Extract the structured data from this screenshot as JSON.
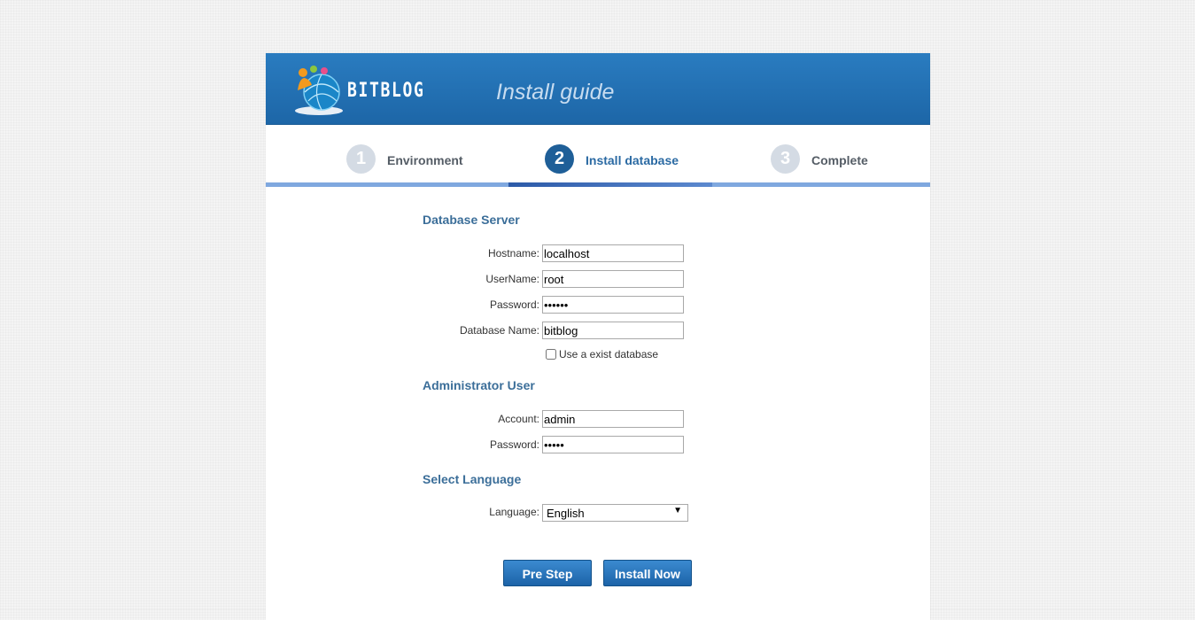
{
  "header": {
    "logo_text": "BITBLOG",
    "title": "Install guide"
  },
  "steps": [
    {
      "num": "1",
      "label": "Environment",
      "active": false
    },
    {
      "num": "2",
      "label": "Install database",
      "active": true
    },
    {
      "num": "3",
      "label": "Complete",
      "active": false
    }
  ],
  "database_server": {
    "title": "Database Server",
    "hostname_label": "Hostname:",
    "hostname_value": "localhost",
    "username_label": "UserName:",
    "username_value": "root",
    "password_label": "Password:",
    "password_value": "••••••",
    "dbname_label": "Database Name:",
    "dbname_value": "bitblog",
    "use_exist_label": "Use a exist database"
  },
  "admin_user": {
    "title": "Administrator User",
    "account_label": "Account:",
    "account_value": "admin",
    "password_label": "Password:",
    "password_value": "•••••"
  },
  "language": {
    "title": "Select Language",
    "label": "Language:",
    "selected": "English"
  },
  "buttons": {
    "pre_step": "Pre Step",
    "install_now": "Install Now"
  }
}
